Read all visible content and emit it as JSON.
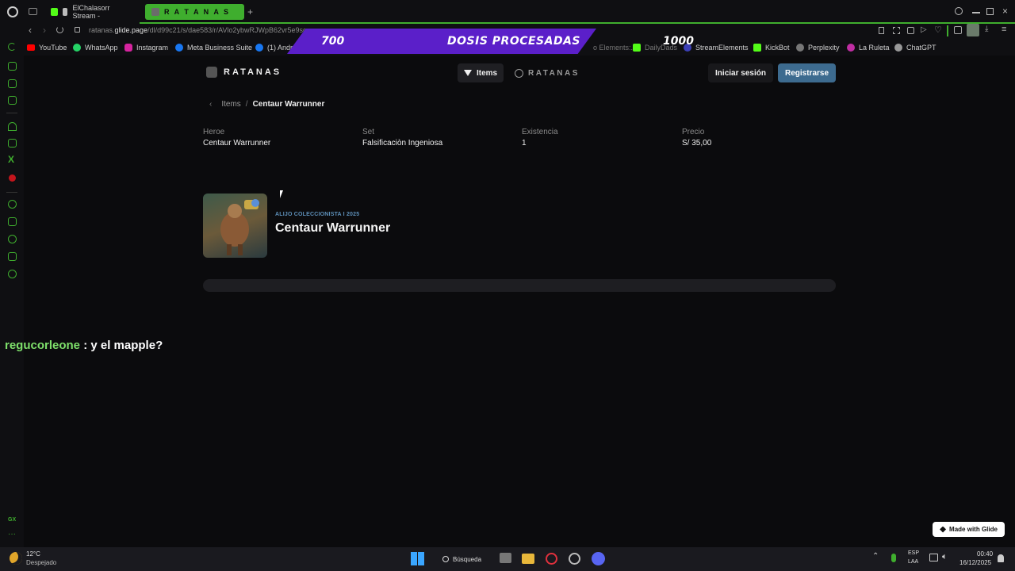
{
  "browser": {
    "tabs": [
      {
        "label": "ElChalasorr Stream - ",
        "active": false
      },
      {
        "label": "R A T A N A S",
        "active": true
      }
    ],
    "url_prefix": "ratanas.",
    "url_domain": "glide.page",
    "url_path": "/dl/d99c21/s/dae583/r/AVlo2ybwRJWpB62vr5e9sg",
    "bookmarks": [
      "YouTube",
      "WhatsApp",
      "Instagram",
      "Meta Business Suite",
      "(1) André",
      "o Elements:...",
      "DailyDads",
      "StreamElements",
      "KickBot",
      "Perplexity",
      "La Ruleta",
      "ChatGPT"
    ]
  },
  "overlay": {
    "left_value": "700",
    "center_text": "DOSIS PROCESADAS",
    "right_value": "1000"
  },
  "app": {
    "brand": "RATANAS",
    "nav_items_label": "Items",
    "nav_brand_label": "RATANAS",
    "signin_label": "Iniciar sesión",
    "register_label": "Registrarse",
    "accent_color": "#3d6b8f"
  },
  "breadcrumb": {
    "parent": "Items",
    "separator": "/",
    "current": "Centaur Warrunner"
  },
  "details": [
    {
      "label": "Heroe",
      "value": "Centaur Warrunner"
    },
    {
      "label": "Set",
      "value": "Falsificaciòn Ingeniosa"
    },
    {
      "label": "Existencia",
      "value": "1"
    },
    {
      "label": "Precio",
      "value": "S/ 35,00"
    }
  ],
  "item": {
    "subtitle": "ALIJO COLECCIONISTA I 2025",
    "title": "Centaur Warrunner"
  },
  "chat": {
    "user": "regucorleone",
    "message": ": y el mapple?"
  },
  "made_with": "Made with Glide",
  "taskbar": {
    "temp": "12°C",
    "weather": "Despejado",
    "search": "Búsqueda",
    "lang1": "ESP",
    "lang2": "LAA",
    "time": "00:40",
    "date": "16/12/2025"
  },
  "sidebar_bottom": "GX"
}
